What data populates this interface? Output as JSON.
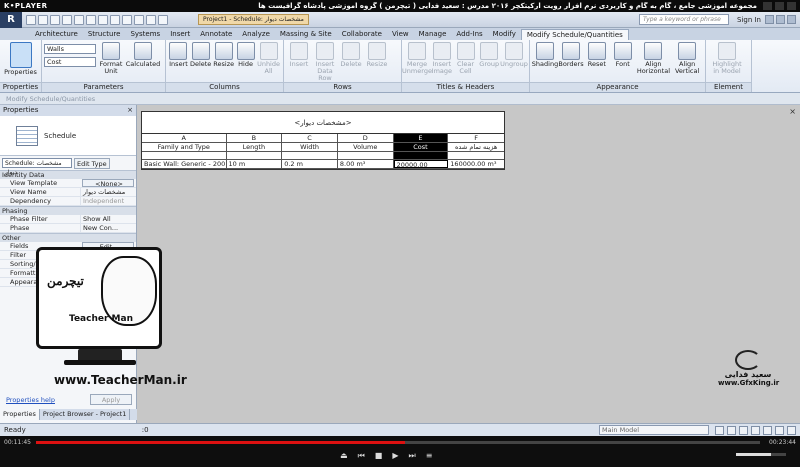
{
  "player": {
    "logo": "K•PLAYER",
    "title": "مجموعه آموزشی جامع ، گام به گام و کاربردی نرم افزار رویت آرکیتکچر ۲۰۱۶   مدرس : سعید فدایی ( تیچرمن ) گروه آموزشی پادشاه گرافیست ها",
    "time_elapsed": "00:11:45",
    "time_total": "00:23:44",
    "progress_fraction": 0.51,
    "volume_fraction": 0.7
  },
  "app": {
    "logo": "R",
    "doc_tab": "Project1 - Schedule: مشخصات دیوار",
    "search_placeholder": "Type a keyword or phrase",
    "sign_in": "Sign In"
  },
  "tabs": [
    "Architecture",
    "Structure",
    "Systems",
    "Insert",
    "Annotate",
    "Analyze",
    "Massing & Site",
    "Collaborate",
    "View",
    "Manage",
    "Add-Ins",
    "Modify",
    "Modify Schedule/Quantities"
  ],
  "active_tab_index": 12,
  "ribbon": {
    "properties": {
      "label": "Properties",
      "btn": "Properties"
    },
    "parameters": {
      "label": "Parameters",
      "combo1": "Walls",
      "combo2": "Cost",
      "format_unit": "Format\nUnit",
      "calculated": "Calculated"
    },
    "columns": {
      "label": "Columns",
      "items": [
        "Insert",
        "Delete",
        "Resize",
        "Hide",
        "Unhide\nAll"
      ]
    },
    "rows": {
      "label": "Rows",
      "items": [
        "Insert",
        "Insert\nData Row",
        "Delete",
        "Resize"
      ]
    },
    "titles": {
      "label": "Titles & Headers",
      "items": [
        "Merge\nUnmerge",
        "Insert\nImage",
        "Clear\nCell",
        "Group",
        "Ungroup"
      ]
    },
    "appearance": {
      "label": "Appearance",
      "items": [
        "Shading",
        "Borders",
        "Reset",
        "Font",
        "Align\nHorizontal",
        "Align\nVertical"
      ]
    },
    "element": {
      "label": "Element",
      "items": [
        "Highlight\nin Model"
      ]
    }
  },
  "modify_bar": "Modify Schedule/Quantities",
  "properties_panel": {
    "header": "Properties",
    "close": "×",
    "type_name": "Schedule",
    "filter_label": "Schedule: مشخصات دیوار",
    "edit_type": "Edit Type",
    "sections": [
      {
        "title": "Identity Data",
        "rows": [
          [
            "View Template",
            "<None>"
          ],
          [
            "View Name",
            "مشخصات دیوار"
          ],
          [
            "Dependency",
            "Independent"
          ]
        ]
      },
      {
        "title": "Phasing",
        "rows": [
          [
            "Phase Filter",
            "Show All"
          ],
          [
            "Phase",
            "New Con..."
          ]
        ]
      },
      {
        "title": "Other",
        "rows": [
          [
            "Fields",
            "Edit..."
          ],
          [
            "Filter",
            "Edit..."
          ],
          [
            "Sorting/Grouping",
            "Edit..."
          ],
          [
            "Formatting",
            "Edit..."
          ],
          [
            "Appearance",
            "Edit..."
          ]
        ]
      }
    ],
    "help": "Properties help",
    "apply": "Apply",
    "bottom_tabs": [
      "Properties",
      "Project Browser - Project1"
    ]
  },
  "schedule": {
    "title": "<مشخصات دیوار>",
    "letters": [
      "A",
      "B",
      "C",
      "D",
      "E",
      "F"
    ],
    "headers": [
      "Family and Type",
      "Length",
      "Width",
      "Volume",
      "Cost",
      "هزینه تمام شده"
    ],
    "selected_col": 4,
    "rows": [
      [
        "Basic Wall: Generic - 200",
        "10 m",
        "0.2 m",
        "8.00 m³",
        "20000.00",
        "160000.00 m³"
      ]
    ]
  },
  "watermarks": {
    "teacherman_logo": "تیچرمن",
    "teacherman_name": "Teacher Man",
    "teacherman_url": "www.TeacherMan.ir",
    "gfx_name": "سعید فدایی",
    "gfx_url": "www.GfxKing.ir"
  },
  "status": {
    "text": "Ready",
    "zero": ":0",
    "model": "Main Model"
  },
  "colors": {
    "accent": "#3c78c3",
    "seek": "#dd1111"
  }
}
